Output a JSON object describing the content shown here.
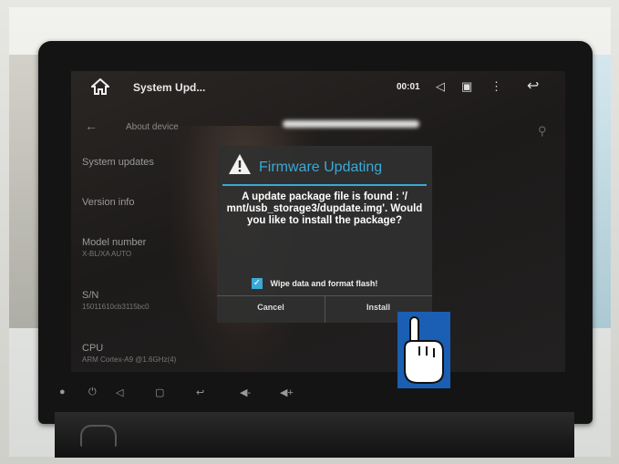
{
  "status_bar": {
    "title": "System Upd...",
    "time": "00:01"
  },
  "settings": {
    "back_label": "About device",
    "items": [
      {
        "label": "System updates",
        "sub": ""
      },
      {
        "label": "Version info",
        "sub": ""
      },
      {
        "label": "Model number",
        "sub": "X-BL/XA AUTO"
      },
      {
        "label": "S/N",
        "sub": "15011610cb3115bc0"
      },
      {
        "label": "CPU",
        "sub": "ARM Cortex-A9 @1.6GHz(4)"
      }
    ]
  },
  "dialog": {
    "title": "Firmware Updating",
    "message": "A update package file is found : '/ mnt/usb_storage3/dupdate.img'. Would you like to install the package?",
    "checkbox_label": "Wipe data and format flash!",
    "checkbox_checked": true,
    "cancel_label": "Cancel",
    "install_label": "Install"
  },
  "icons": {
    "home": "home-icon",
    "volume": "volume-icon",
    "screenshot": "screen-icon",
    "menu": "more-vert-icon",
    "back": "back-icon",
    "warning": "warning-icon",
    "pointer": "pointing-hand-icon"
  },
  "colors": {
    "accent": "#39a9d6",
    "dialog_bg": "#303030",
    "pointer_bg": "#1a5fb3"
  }
}
